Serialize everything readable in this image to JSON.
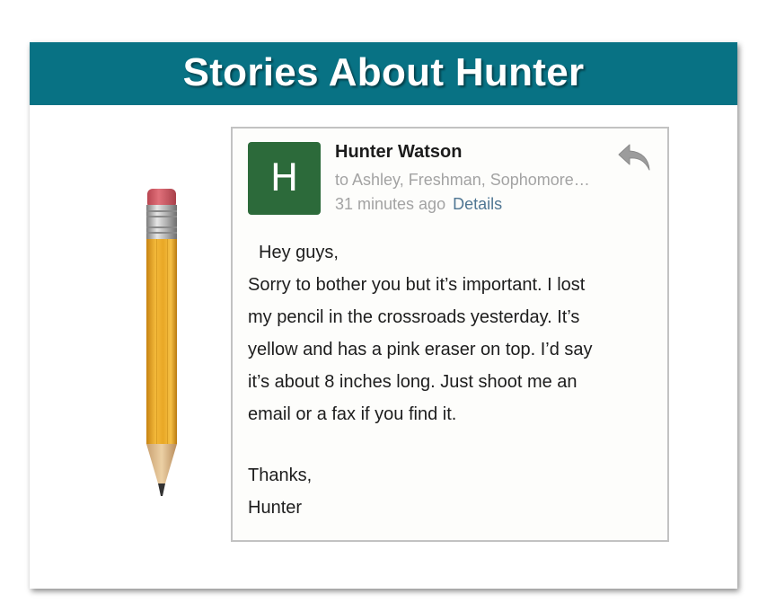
{
  "banner": {
    "title": "Stories About Hunter",
    "color": "#087284"
  },
  "illustration": {
    "icon": "pencil-icon",
    "colors": {
      "body": "#e8a92a",
      "eraser": "#d8606a",
      "ferrule": "#b5b5b5",
      "tip": "#3a3a3a"
    }
  },
  "email": {
    "avatar_letter": "H",
    "avatar_color": "#2c6a3a",
    "sender": "Hunter Watson",
    "recipients": "to Ashley, Freshman, Sophomore…",
    "time": "31 minutes ago",
    "details_label": "Details",
    "reply_icon": "reply-arrow-icon",
    "greeting": "Hey guys,",
    "paragraph_lines": [
      "Sorry to bother you but it’s important. I lost",
      "my pencil in the crossroads yesterday. It’s",
      "yellow and has a pink eraser on top. I’d say",
      "it’s about 8 inches long. Just shoot me an",
      "email or a fax if you find it."
    ],
    "signoff": "Thanks,",
    "signature": "Hunter"
  }
}
